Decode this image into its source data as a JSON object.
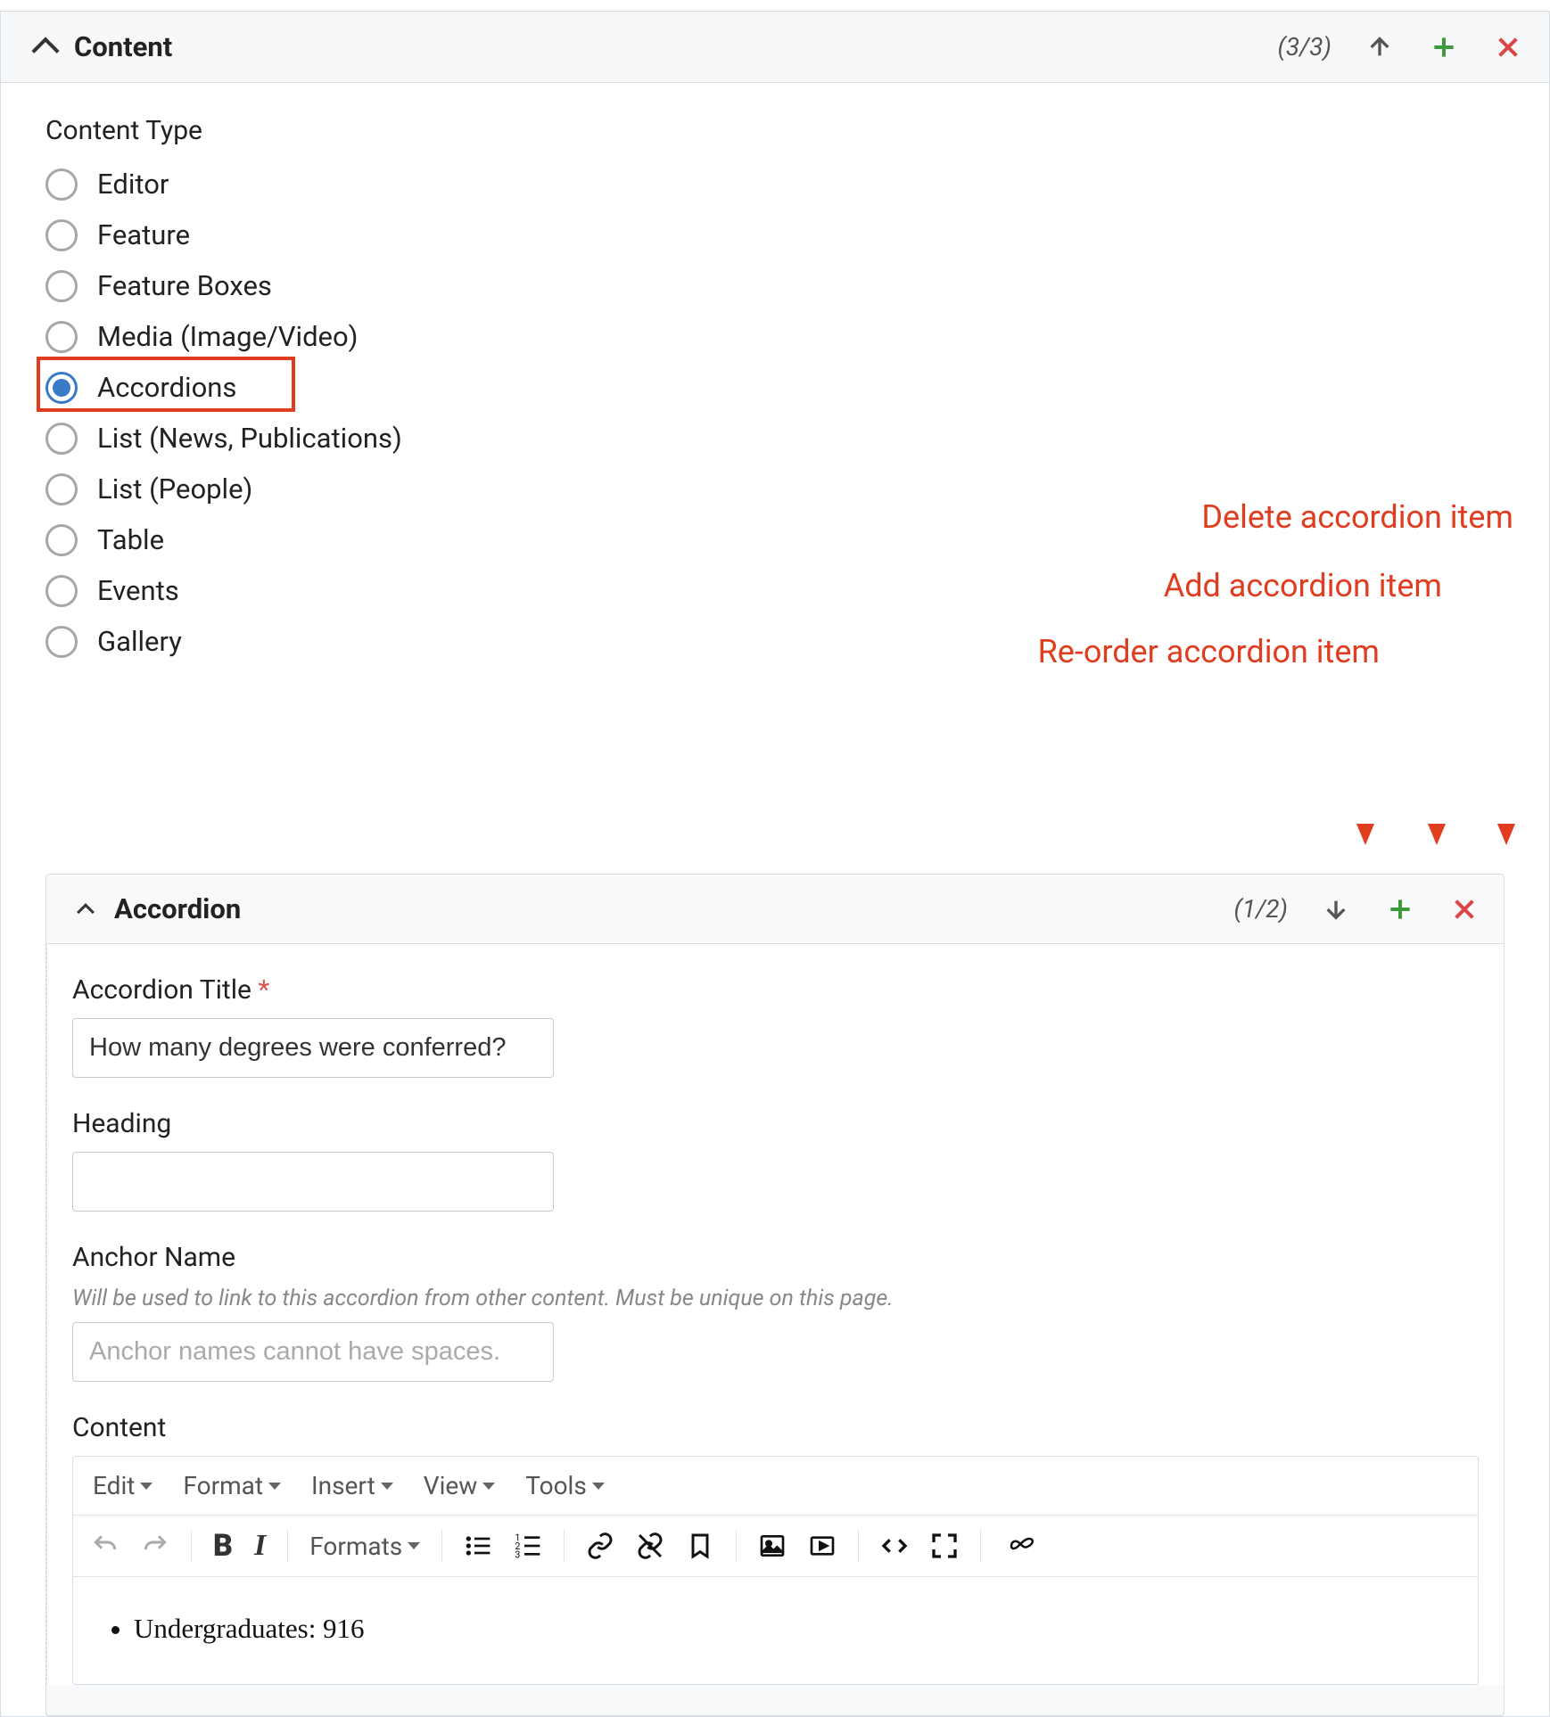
{
  "content_panel": {
    "title": "Content",
    "count": "(3/3)"
  },
  "content_type": {
    "label": "Content Type",
    "options": [
      {
        "label": "Editor",
        "selected": false
      },
      {
        "label": "Feature",
        "selected": false
      },
      {
        "label": "Feature Boxes",
        "selected": false
      },
      {
        "label": "Media (Image/Video)",
        "selected": false
      },
      {
        "label": "Accordions",
        "selected": true
      },
      {
        "label": "List (News, Publications)",
        "selected": false
      },
      {
        "label": "List (People)",
        "selected": false
      },
      {
        "label": "Table",
        "selected": false
      },
      {
        "label": "Events",
        "selected": false
      },
      {
        "label": "Gallery",
        "selected": false
      }
    ]
  },
  "annotations": {
    "delete": "Delete accordion item",
    "add": "Add accordion item",
    "reorder": "Re-order accordion item"
  },
  "accordion_panel": {
    "title": "Accordion",
    "count": "(1/2)"
  },
  "fields": {
    "accordion_title": {
      "label": "Accordion Title",
      "value": "How many degrees were conferred?"
    },
    "heading": {
      "label": "Heading",
      "value": ""
    },
    "anchor": {
      "label": "Anchor Name",
      "help": "Will be used to link to this accordion from other content. Must be unique on this page.",
      "placeholder": "Anchor names cannot have spaces."
    },
    "content": {
      "label": "Content"
    }
  },
  "editor": {
    "menus": [
      "Edit",
      "Format",
      "Insert",
      "View",
      "Tools"
    ],
    "formats_label": "Formats",
    "body_item": "Undergraduates: 916"
  }
}
